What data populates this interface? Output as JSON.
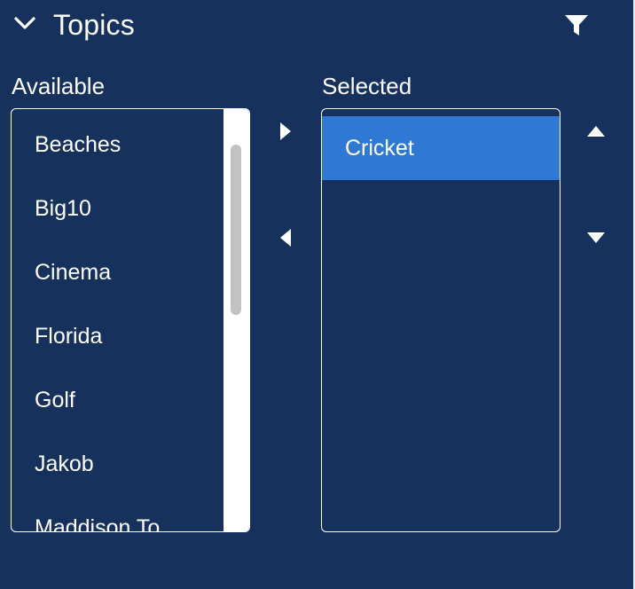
{
  "header": {
    "title": "Topics"
  },
  "available": {
    "label": "Available",
    "items": [
      "Beaches",
      "Big10",
      "Cinema",
      "Florida",
      "Golf",
      "Jakob",
      "Maddison To"
    ]
  },
  "selected": {
    "label": "Selected",
    "items": [
      "Cricket"
    ]
  },
  "colors": {
    "background": "#16325c",
    "selected_item": "#2f78d3",
    "text": "#ffffff"
  },
  "icons": {
    "collapse": "chevron-down-icon",
    "filter": "filter-icon",
    "move_right": "triangle-right-icon",
    "move_left": "triangle-left-icon",
    "move_up": "triangle-up-icon",
    "move_down": "triangle-down-icon"
  }
}
